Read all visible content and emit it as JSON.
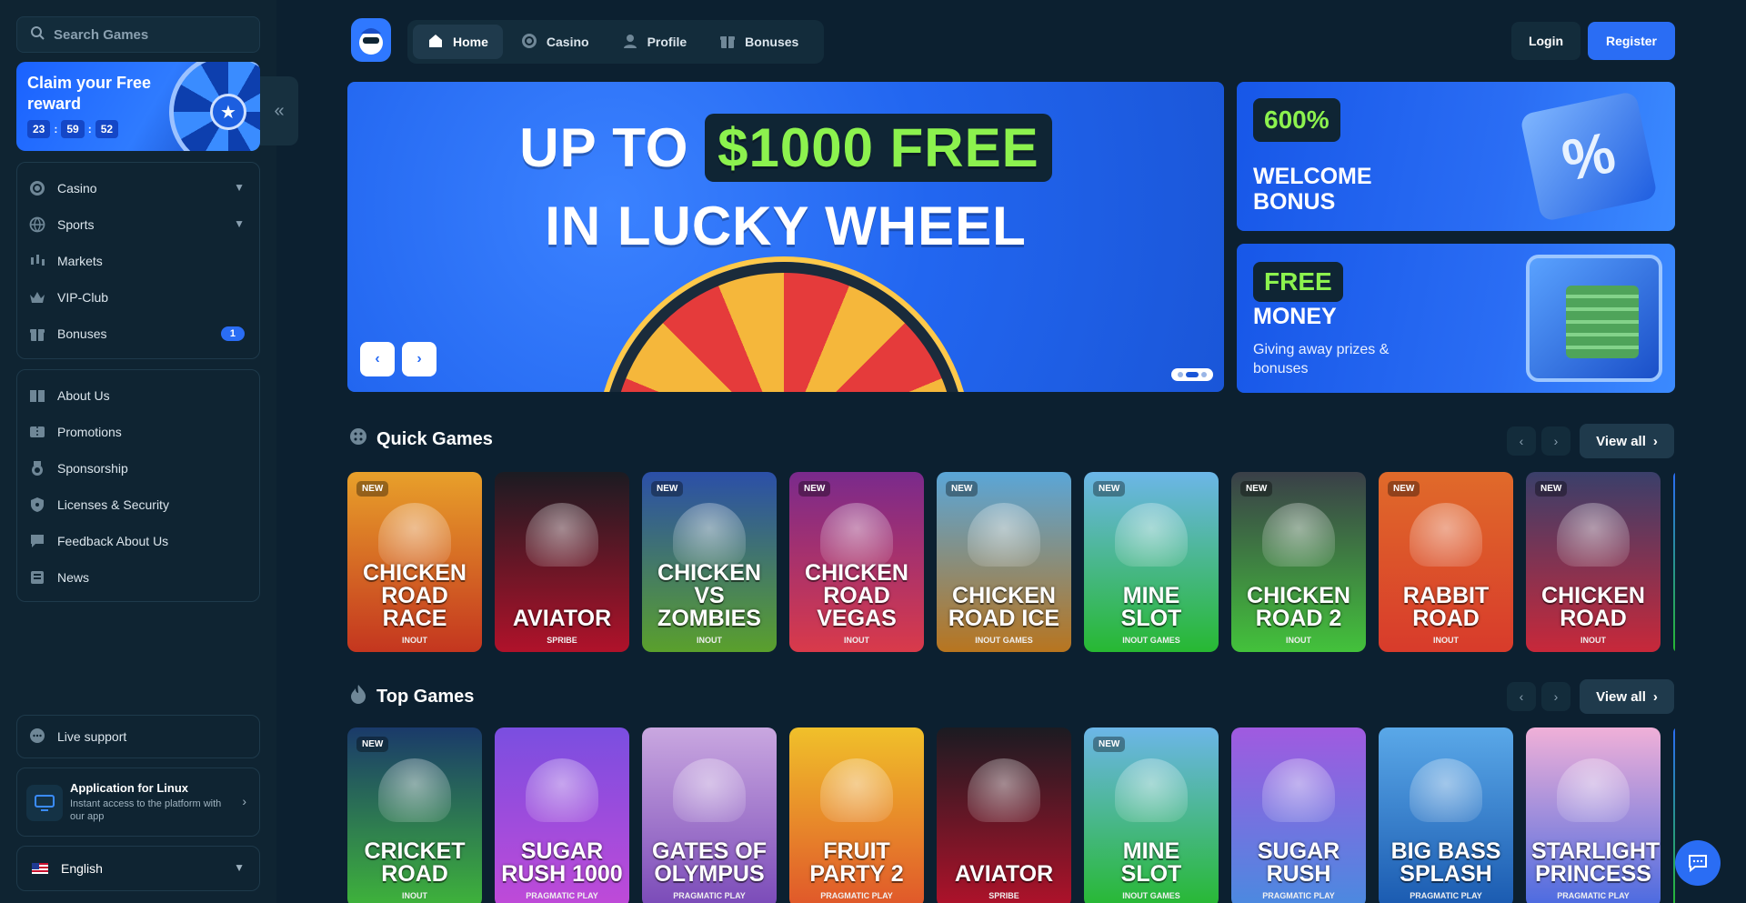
{
  "search": {
    "placeholder": "Search Games"
  },
  "reward": {
    "title": "Claim your Free reward",
    "timer": [
      "23",
      "59",
      "52"
    ]
  },
  "sidebar": {
    "main_items": [
      {
        "label": "Casino",
        "icon": "casino-chip-icon",
        "chevron": true
      },
      {
        "label": "Sports",
        "icon": "globe-ball-icon",
        "chevron": true
      },
      {
        "label": "Markets",
        "icon": "candlestick-icon"
      },
      {
        "label": "VIP-Club",
        "icon": "crown-icon"
      },
      {
        "label": "Bonuses",
        "icon": "gift-icon",
        "badge": "1"
      }
    ],
    "info_items": [
      {
        "label": "About Us",
        "icon": "book-icon"
      },
      {
        "label": "Promotions",
        "icon": "tickets-icon"
      },
      {
        "label": "Sponsorship",
        "icon": "medal-icon"
      },
      {
        "label": "Licenses & Security",
        "icon": "shield-icon"
      },
      {
        "label": "Feedback About Us",
        "icon": "chat-bubble-icon"
      },
      {
        "label": "News",
        "icon": "news-icon"
      }
    ],
    "support_label": "Live support",
    "app": {
      "title": "Application for Linux",
      "subtitle": "Instant access to the platform with our app"
    },
    "language": "English"
  },
  "topnav": {
    "tabs": [
      {
        "label": "Home",
        "icon": "home-icon",
        "active": true
      },
      {
        "label": "Casino",
        "icon": "casino-chip-icon"
      },
      {
        "label": "Profile",
        "icon": "user-icon"
      },
      {
        "label": "Bonuses",
        "icon": "gift-icon"
      }
    ],
    "login": "Login",
    "register": "Register"
  },
  "hero": {
    "line1_a": "UP TO",
    "line1_highlight": "$1000 FREE",
    "line2": "IN LUCKY WHEEL",
    "prev": "‹",
    "next": "›"
  },
  "promos": [
    {
      "pill": "600%",
      "title": "WELCOME BONUS",
      "subtitle": ""
    },
    {
      "pill": "FREE",
      "title": "MONEY",
      "subtitle": "Giving away prizes & bonuses"
    }
  ],
  "sections": {
    "quick": {
      "title": "Quick Games",
      "view_all": "View all",
      "games": [
        {
          "name": "Chicken Road Race",
          "provider": "INOUT",
          "new": true,
          "bg": "#e8a02a",
          "bg2": "#c4361f"
        },
        {
          "name": "Aviator",
          "provider": "SPRIBE",
          "new": false,
          "bg": "#1b1b22",
          "bg2": "#b0122a"
        },
        {
          "name": "Chicken vs Zombies",
          "provider": "INOUT",
          "new": true,
          "bg": "#2b4fa8",
          "bg2": "#5aa02c"
        },
        {
          "name": "Chicken Road Vegas",
          "provider": "INOUT",
          "new": true,
          "bg": "#7a2a8c",
          "bg2": "#d93a4a"
        },
        {
          "name": "Chicken Road Ice",
          "provider": "INOUT GAMES",
          "new": true,
          "bg": "#5aa6d8",
          "bg2": "#b8751f"
        },
        {
          "name": "Mine Slot",
          "provider": "INOUT GAMES",
          "new": true,
          "bg": "#6cb6e8",
          "bg2": "#27b832"
        },
        {
          "name": "Chicken Road 2",
          "provider": "INOUT",
          "new": true,
          "bg": "#3a3f48",
          "bg2": "#43c23b"
        },
        {
          "name": "Rabbit Road",
          "provider": "INOUT",
          "new": true,
          "bg": "#e06a2a",
          "bg2": "#d83b2b"
        },
        {
          "name": "Chicken Road",
          "provider": "INOUT",
          "new": true,
          "bg": "#3a3f6a",
          "bg2": "#c8283a"
        }
      ]
    },
    "top": {
      "title": "Top Games",
      "view_all": "View all",
      "games": [
        {
          "name": "Cricket Road",
          "provider": "INOUT",
          "new": true,
          "bg": "#1a3a6a",
          "bg2": "#3fb43a"
        },
        {
          "name": "Sugar Rush 1000",
          "provider": "PRAGMATIC PLAY",
          "new": false,
          "bg": "#7a4ee0",
          "bg2": "#c04ad8"
        },
        {
          "name": "Gates of Olympus",
          "provider": "PRAGMATIC PLAY",
          "new": false,
          "bg": "#c9a7e0",
          "bg2": "#7a4ab8"
        },
        {
          "name": "Fruit Party 2",
          "provider": "PRAGMATIC PLAY",
          "new": false,
          "bg": "#f0c02a",
          "bg2": "#e0572a"
        },
        {
          "name": "Aviator",
          "provider": "SPRIBE",
          "new": false,
          "bg": "#1b1b22",
          "bg2": "#b0122a"
        },
        {
          "name": "Mine Slot",
          "provider": "INOUT GAMES",
          "new": true,
          "bg": "#6cb6e8",
          "bg2": "#27b832"
        },
        {
          "name": "Sugar Rush",
          "provider": "PRAGMATIC PLAY",
          "new": false,
          "bg": "#a05ae0",
          "bg2": "#4a8ae0"
        },
        {
          "name": "Big Bass Splash",
          "provider": "PRAGMATIC PLAY",
          "new": false,
          "bg": "#5aa8e8",
          "bg2": "#1a5ab0"
        },
        {
          "name": "Starlight Princess",
          "provider": "PRAGMATIC PLAY",
          "new": false,
          "bg": "#f0b0d8",
          "bg2": "#4a6ae0"
        }
      ]
    }
  },
  "colors": {
    "accent": "#2a6df4",
    "highlight_green": "#8cf24e",
    "bg": "#0c2030",
    "sidebar": "#0f2432"
  }
}
